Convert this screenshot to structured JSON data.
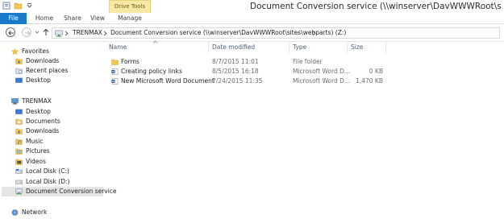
{
  "window": {
    "title": "Document Conversion service (\\\\winserver\\DavWWWRoot\\sites\\webparts) (Z:)",
    "context_tab_group": "Drive Tools"
  },
  "ribbon": {
    "tabs": [
      {
        "label": "File"
      },
      {
        "label": "Home"
      },
      {
        "label": "Share"
      },
      {
        "label": "View"
      },
      {
        "label": "Manage"
      }
    ]
  },
  "address": {
    "segments": [
      "TRENMAX",
      "Document Conversion service (\\\\winserver\\DavWWWRoot\\sites\\webparts) (Z:)"
    ]
  },
  "navpane": {
    "favorites": {
      "label": "Favorites",
      "items": [
        "Downloads",
        "Recent places",
        "Desktop"
      ]
    },
    "computer": {
      "label": "TRENMAX",
      "items": [
        "Desktop",
        "Documents",
        "Downloads",
        "Music",
        "Pictures",
        "Videos",
        "Local Disk (C:)",
        "Local Disk (D:)",
        "Document Conversion service"
      ]
    },
    "network": {
      "label": "Network"
    }
  },
  "filelist": {
    "columns": [
      "Name",
      "Date modified",
      "Type",
      "Size"
    ],
    "rows": [
      {
        "name": "Forms",
        "date": "8/7/2015 11:01",
        "type": "File folder",
        "size": "",
        "icon": "folder-icon"
      },
      {
        "name": "Creating policy links",
        "date": "8/5/2015 16:18",
        "type": "Microsoft Word D...",
        "size": "0 KB",
        "icon": "word-document-icon"
      },
      {
        "name": "New Microsoft Word Document",
        "date": "7/24/2015 11:35",
        "type": "Microsoft Word D...",
        "size": "1,470 KB",
        "icon": "word-document-icon"
      }
    ]
  },
  "colors": {
    "file_tab": "#1979ca",
    "context_tab": "#f7e9a4",
    "selected_nav": "#e5e5e5",
    "column_header_text": "#4c607a"
  }
}
